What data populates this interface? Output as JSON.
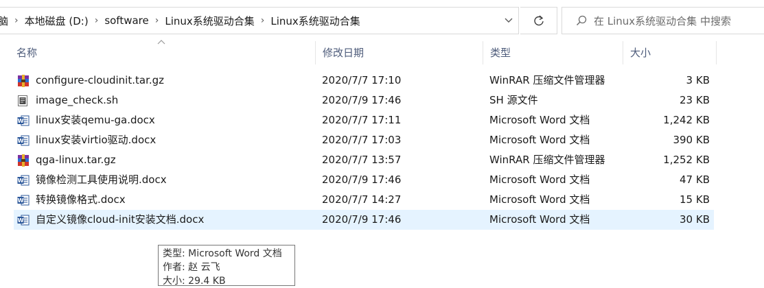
{
  "address_bar": {
    "breadcrumbs": [
      "脑",
      "本地磁盘 (D:)",
      "software",
      "Linux系统驱动合集",
      "Linux系统驱动合集"
    ],
    "separator": "›",
    "dropdown_icon": "chevron-down-icon"
  },
  "refresh": {
    "icon": "refresh-icon"
  },
  "search": {
    "placeholder": "在 Linux系统驱动合集 中搜索",
    "icon": "search-icon"
  },
  "columns": {
    "name": "名称",
    "date": "修改日期",
    "type": "类型",
    "size": "大小"
  },
  "files": [
    {
      "name": "configure-cloudinit.tar.gz",
      "date": "2020/7/7 17:10",
      "type": "WinRAR 压缩文件管理器",
      "size": "3 KB",
      "icon": "winrar-icon"
    },
    {
      "name": "image_check.sh",
      "date": "2020/7/9 17:46",
      "type": "SH 源文件",
      "size": "23 KB",
      "icon": "script-file-icon"
    },
    {
      "name": "linux安装qemu-ga.docx",
      "date": "2020/7/7 17:11",
      "type": "Microsoft Word 文档",
      "size": "1,242 KB",
      "icon": "word-icon"
    },
    {
      "name": "linux安装virtio驱动.docx",
      "date": "2020/7/7 17:03",
      "type": "Microsoft Word 文档",
      "size": "390 KB",
      "icon": "word-icon"
    },
    {
      "name": "qga-linux.tar.gz",
      "date": "2020/7/7 13:57",
      "type": "WinRAR 压缩文件管理器",
      "size": "1,252 KB",
      "icon": "winrar-icon"
    },
    {
      "name": "镜像检测工具使用说明.docx",
      "date": "2020/7/9 17:46",
      "type": "Microsoft Word 文档",
      "size": "47 KB",
      "icon": "word-icon"
    },
    {
      "name": "转换镜像格式.docx",
      "date": "2020/7/7 14:27",
      "type": "Microsoft Word 文档",
      "size": "15 KB",
      "icon": "word-icon"
    },
    {
      "name": "自定义镜像cloud-init安装文档.docx",
      "date": "2020/7/9 17:46",
      "type": "Microsoft Word 文档",
      "size": "30 KB",
      "icon": "word-icon"
    }
  ],
  "tooltip": {
    "type_line": "类型: Microsoft Word 文档",
    "author_line": "作者: 赵 云飞",
    "size_line": "大小: 29.4 KB"
  },
  "colors": {
    "selection": "#e5f3ff",
    "header_text": "#4d5b7a",
    "word_blue": "#2b579a"
  }
}
